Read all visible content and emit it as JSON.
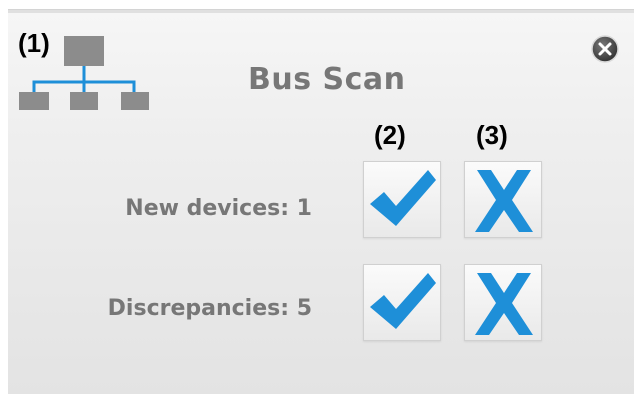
{
  "markers": {
    "one": "(1)",
    "two": "(2)",
    "three": "(3)"
  },
  "dialog": {
    "title": "Bus Scan",
    "close_icon": "close-icon"
  },
  "rows": [
    {
      "label": "New devices: 1",
      "accept_icon": "checkmark-icon",
      "reject_icon": "x-icon"
    },
    {
      "label": "Discrepancies: 5",
      "accept_icon": "checkmark-icon",
      "reject_icon": "x-icon"
    }
  ],
  "colors": {
    "accent_blue": "#1e8fd8",
    "icon_gray": "#8c8c8c",
    "label_gray": "#777777"
  }
}
